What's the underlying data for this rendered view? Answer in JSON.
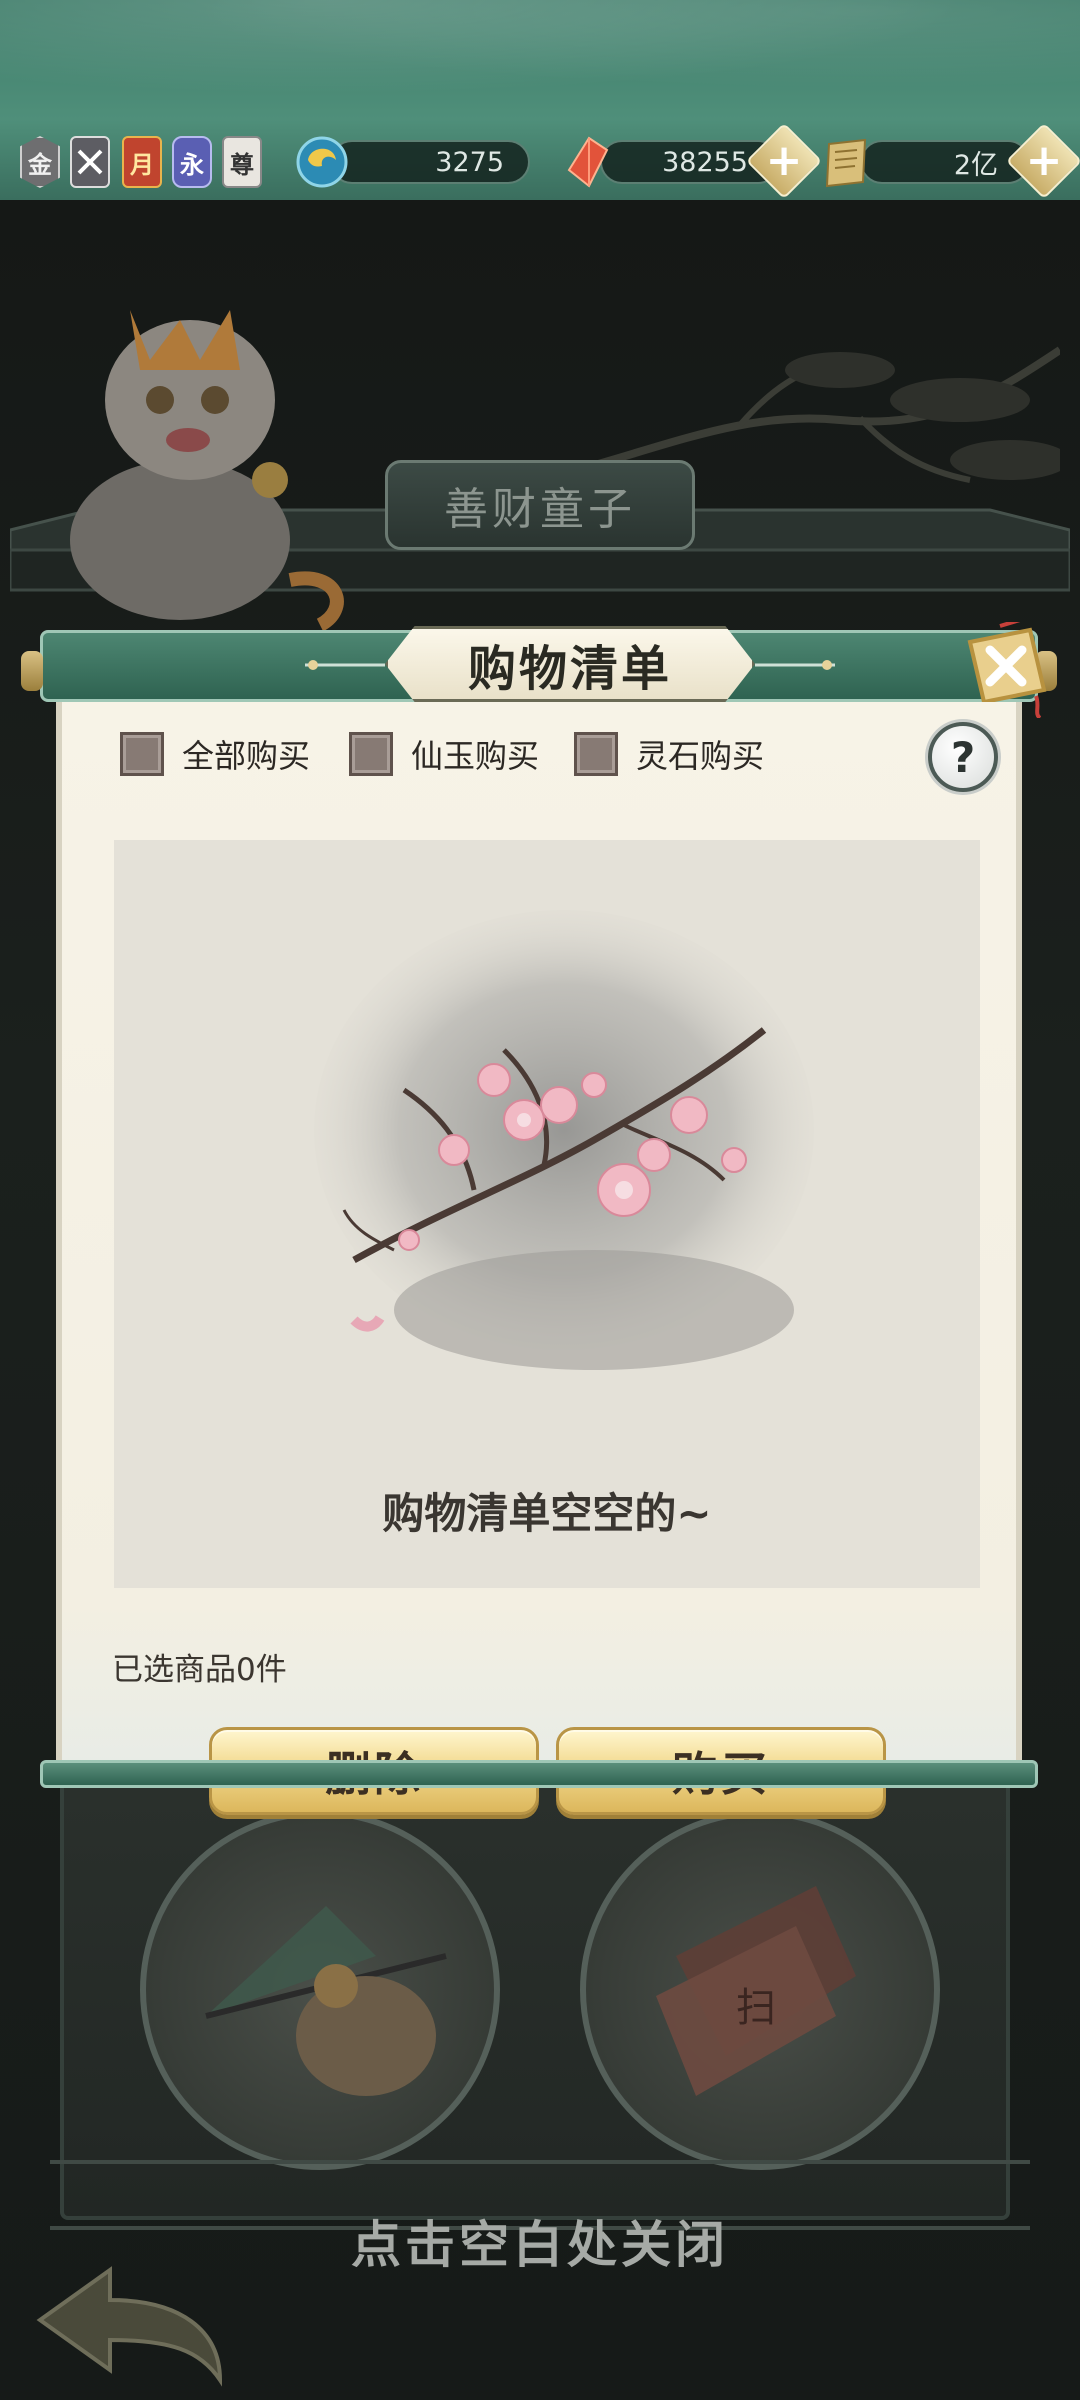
{
  "topbar": {
    "badges": [
      {
        "icon": "gold-badge-icon",
        "label": "金"
      },
      {
        "icon": "crossed-swords-badge-icon",
        "label": ""
      },
      {
        "icon": "monthly-card-icon",
        "label": "月"
      },
      {
        "icon": "permanent-card-icon",
        "label": "永"
      },
      {
        "icon": "supreme-badge-icon",
        "label": "尊"
      }
    ],
    "resources": [
      {
        "icon": "spirit-orb-icon",
        "value": "3275"
      },
      {
        "icon": "red-crystal-icon",
        "value": "38255"
      },
      {
        "icon": "scroll-currency-icon",
        "value": "2亿"
      }
    ]
  },
  "background": {
    "shop_title": "善财童子",
    "close_hint": "点击空白处关闭"
  },
  "dialog": {
    "title": "购物清单",
    "filters": [
      "全部购买",
      "仙玉购买",
      "灵石购买"
    ],
    "help_label": "?",
    "empty_text": "购物清单空空的~",
    "selected_text": "已选商品0件",
    "delete_label": "删除",
    "buy_label": "购买"
  },
  "colors": {
    "header_green": "#2f6351",
    "paper": "#f7f3e7",
    "button_gold": "#f2d98e",
    "checkbox": "#877a74"
  }
}
